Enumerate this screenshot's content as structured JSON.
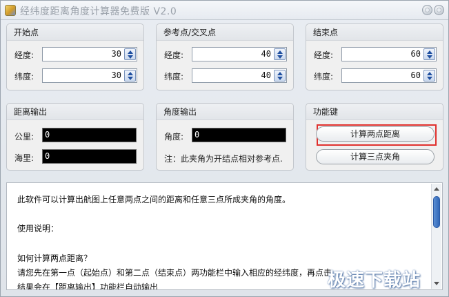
{
  "window": {
    "title": "经纬度距离角度计算器免费版 V2.0"
  },
  "groups": {
    "start": {
      "title": "开始点",
      "lon_label": "经度:",
      "lon_value": "30",
      "lat_label": "纬度:",
      "lat_value": "30"
    },
    "ref": {
      "title": "参考点/交叉点",
      "lon_label": "经度:",
      "lon_value": "40",
      "lat_label": "纬度:",
      "lat_value": "40"
    },
    "end": {
      "title": "结束点",
      "lon_label": "经度:",
      "lon_value": "60",
      "lat_label": "纬度:",
      "lat_value": "60"
    },
    "distance": {
      "title": "距离输出",
      "km_label": "公里:",
      "km_value": "0",
      "nmi_label": "海里:",
      "nmi_value": "0"
    },
    "angle": {
      "title": "角度输出",
      "angle_label": "角度:",
      "angle_value": "0",
      "note": "注：此夹角为开结点相对参考点."
    },
    "functions": {
      "title": "功能键",
      "btn_distance": "计算两点距离",
      "btn_angle": "计算三点夹角"
    }
  },
  "help": {
    "lines": [
      "此软件可以计算出航图上任意两点之间的距离和任意三点所成夹角的角度。",
      "使用说明：",
      "如何计算两点距离？",
      "请您先在第一点（起始点）和第二点（结束点）两功能栏中输入相应的经纬度，再点击",
      "结果会在【距离输出】功能栏自动输出"
    ]
  },
  "watermark": "极速下载站",
  "colors": {
    "highlight": "#e0302d",
    "output_bg": "#000000",
    "scroll_thumb": "#2f66b8"
  }
}
